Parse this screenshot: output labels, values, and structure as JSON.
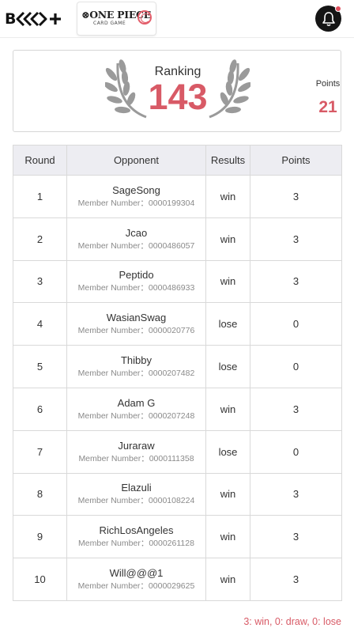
{
  "header": {
    "bandai_logo_text": "B",
    "game_logo_title": "ONE PIECE",
    "game_logo_subtitle": "CARD GAME",
    "notification_badge_color": "#e04e5c"
  },
  "ranking_card": {
    "ranking_label": "Ranking",
    "ranking_value": "143",
    "points_label": "Points",
    "points_value": "21",
    "accent_color": "#d85a66"
  },
  "table": {
    "columns": [
      "Round",
      "Opponent",
      "Results",
      "Points"
    ],
    "member_prefix": "Member Number：",
    "rows": [
      {
        "round": "1",
        "opponent": "SageSong",
        "member": "Member Number：0000199304",
        "result": "win",
        "points": "3"
      },
      {
        "round": "2",
        "opponent": "Jcao",
        "member": "Member Number：0000486057",
        "result": "win",
        "points": "3"
      },
      {
        "round": "3",
        "opponent": "Peptido",
        "member": "Member Number：0000486933",
        "result": "win",
        "points": "3"
      },
      {
        "round": "4",
        "opponent": "WasianSwag",
        "member": "Member Number：0000020776",
        "result": "lose",
        "points": "0"
      },
      {
        "round": "5",
        "opponent": "Thibby",
        "member": "Member Number：0000207482",
        "result": "lose",
        "points": "0"
      },
      {
        "round": "6",
        "opponent": "Adam G",
        "member": "Member Number：0000207248",
        "result": "win",
        "points": "3"
      },
      {
        "round": "7",
        "opponent": "Juraraw",
        "member": "Member Number：0000111358",
        "result": "lose",
        "points": "0"
      },
      {
        "round": "8",
        "opponent": "Elazuli",
        "member": "Member Number：0000108224",
        "result": "win",
        "points": "3"
      },
      {
        "round": "9",
        "opponent": "RichLosAngeles",
        "member": "Member Number：0000261128",
        "result": "win",
        "points": "3"
      },
      {
        "round": "10",
        "opponent": "Will@@@1",
        "member": "Member Number：0000029625",
        "result": "win",
        "points": "3"
      }
    ]
  },
  "legend": "3: win, 0: draw, 0: lose"
}
